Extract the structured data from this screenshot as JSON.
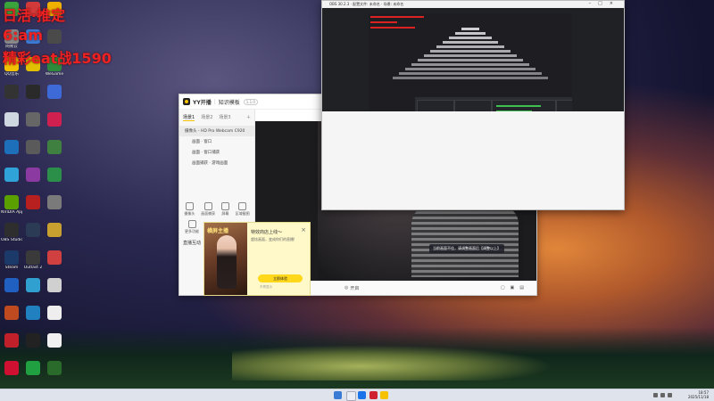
{
  "overlay": {
    "line1": "日活·推定",
    "line2": "6:am",
    "line3": "精彩eat战1590"
  },
  "desktop_icons": [
    {
      "label": "",
      "color": "#3ba33b"
    },
    {
      "label": "",
      "color": "#d23a3a"
    },
    {
      "label": "",
      "color": "#f0b000"
    },
    {
      "label": "网易云",
      "color": "#8a8a8a"
    },
    {
      "label": "",
      "color": "#3a7bd5"
    },
    {
      "label": "",
      "color": "#4a4a4a"
    },
    {
      "label": "QQ音乐",
      "color": "#f2c200"
    },
    {
      "label": "",
      "color": "#e0c000"
    },
    {
      "label": "WeGame",
      "color": "#2d8a3a"
    },
    {
      "label": "",
      "color": "#333333"
    },
    {
      "label": "",
      "color": "#2a2a2a"
    },
    {
      "label": "",
      "color": "#3d6ad6"
    },
    {
      "label": "",
      "color": "#cfd7e0"
    },
    {
      "label": "",
      "color": "#666666"
    },
    {
      "label": "",
      "color": "#d02050"
    },
    {
      "label": "",
      "color": "#1c6fb8"
    },
    {
      "label": "",
      "color": "#5a5a5a"
    },
    {
      "label": "",
      "color": "#3f7f3f"
    },
    {
      "label": "",
      "color": "#2fa2d8"
    },
    {
      "label": "",
      "color": "#8a3aa0"
    },
    {
      "label": "",
      "color": "#2b8f4a"
    },
    {
      "label": "NVIDIA App",
      "color": "#5aa000"
    },
    {
      "label": "",
      "color": "#b82020"
    },
    {
      "label": "",
      "color": "#7a7a7a"
    },
    {
      "label": "OBS Studio",
      "color": "#2e2e2e"
    },
    {
      "label": "",
      "color": "#2b3a55"
    },
    {
      "label": "",
      "color": "#c8a030"
    },
    {
      "label": "Steam",
      "color": "#1b3a6a"
    },
    {
      "label": "Outlast 2",
      "color": "#3a3a3a"
    },
    {
      "label": "",
      "color": "#d04040"
    },
    {
      "label": "",
      "color": "#2060c0"
    },
    {
      "label": "",
      "color": "#30a0d0"
    },
    {
      "label": "",
      "color": "#d0d0d0"
    },
    {
      "label": "",
      "color": "#c04a20"
    },
    {
      "label": "",
      "color": "#2080c0"
    },
    {
      "label": "",
      "color": "#eeeeee"
    },
    {
      "label": "",
      "color": "#c0202a"
    },
    {
      "label": "",
      "color": "#222222"
    },
    {
      "label": "",
      "color": "#f0f0f0"
    },
    {
      "label": "",
      "color": "#d01030"
    },
    {
      "label": "",
      "color": "#20a040"
    },
    {
      "label": "",
      "color": "#2a6a2a"
    }
  ],
  "yy": {
    "app_name": "YY开播",
    "window_title": "知识模板",
    "badge": "1.1.0",
    "tabs": [
      "场景1",
      "场景2",
      "场景3"
    ],
    "sources": [
      "摄像头 - HD Pro Webcam C920",
      "画面 · 窗口",
      "画面 · 窗口捕获",
      "画面捕获 · 游戏画面"
    ],
    "tools": [
      "摄像头",
      "画面捕获",
      "屏幕",
      "区域截图"
    ],
    "tools2": [
      "更多功能"
    ],
    "live_label": "直播互动",
    "toast": "当前画面不佳，请调整画面后【调整以上】",
    "bottom_label": "开启"
  },
  "promo": {
    "img_sign": "横屏主播",
    "title": "特效商店上线～",
    "subtitle": "超炫画面，变成你们的直播!",
    "button": "立即体验",
    "note": "不再显示",
    "close": "×"
  },
  "obs": {
    "title": "OBS 30.2.3 · 配置文件: 未命名 · 场景: 未命名",
    "controls": "–□×"
  },
  "taskbar": {
    "time": "18:57",
    "date": "2025/11/18",
    "icons": [
      "#3a7bd5",
      "#e8edf4",
      "#1a73e8",
      "#1a3a6a",
      "#d02030",
      "#f6c200"
    ]
  }
}
